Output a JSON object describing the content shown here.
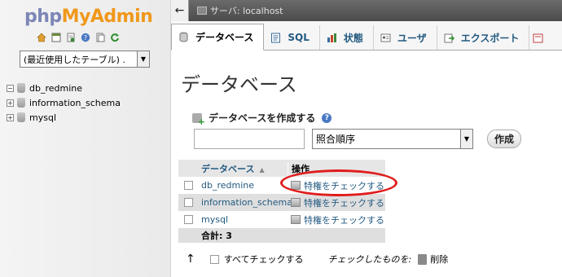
{
  "nav": {
    "logo": {
      "php": "php",
      "my": "My",
      "admin": "Admin"
    },
    "icons": [
      "home-icon",
      "table-icon",
      "query-icon",
      "info-icon",
      "docs-icon",
      "reload-icon"
    ],
    "table_select": "(最近使用したテーブル) .",
    "databases": [
      "db_redmine",
      "information_schema",
      "mysql"
    ]
  },
  "topbar": {
    "back": "←",
    "breadcrumb": "サーバ: localhost"
  },
  "tabs": [
    {
      "label": "データベース",
      "icon": "database-icon",
      "active": true
    },
    {
      "label": "SQL",
      "icon": "sql-icon"
    },
    {
      "label": "状態",
      "icon": "status-icon"
    },
    {
      "label": "ユーザ",
      "icon": "users-icon"
    },
    {
      "label": "エクスポート",
      "icon": "export-icon"
    }
  ],
  "main": {
    "title": "データベース",
    "create": {
      "heading": "データベースを作成する",
      "help": "?",
      "name_value": "",
      "collation": "照合順序",
      "button": "作成"
    },
    "table": {
      "col_db": "データベース",
      "col_action": "操作",
      "rows": [
        {
          "name": "db_redmine",
          "action": "特権をチェックする"
        },
        {
          "name": "information_schema",
          "action": "特権をチェックする"
        },
        {
          "name": "mysql",
          "action": "特権をチェックする"
        }
      ],
      "total": "合計: 3"
    },
    "footer": {
      "up_arrow": "↑",
      "check_all": "すべてチェックする",
      "with_selected": "チェックしたものを:",
      "delete": "削除"
    }
  },
  "colors": {
    "link": "#235a81",
    "annotation": "#e01c1c",
    "logo_php": "#7d86b6",
    "logo_myadmin": "#f0981b"
  }
}
